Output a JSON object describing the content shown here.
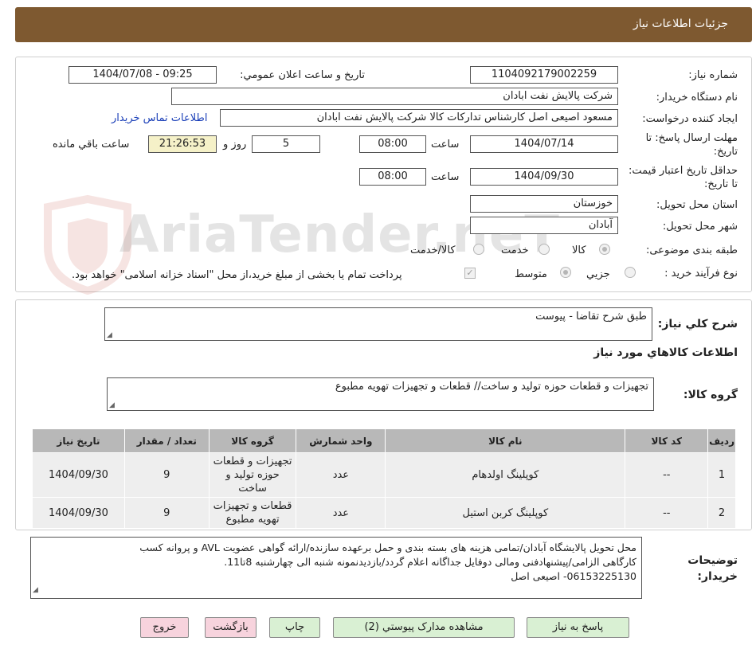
{
  "header": {
    "title": "جزئيات اطلاعات نياز"
  },
  "watermark": {
    "text": "AriaTender.neT"
  },
  "form": {
    "need_number_label": "شماره نياز:",
    "need_number": "1104092179002259",
    "announce_label": "تاريخ و ساعت اعلان عمومي:",
    "announce_value": "1404/07/08 - 09:25",
    "buyer_label": "نام دستگاه خريدار:",
    "buyer_value": "شرکت پالايش نفت ابادان",
    "creator_label": "ايجاد کننده درخواست:",
    "creator_value": "مسعود اصيعی اصل کارشناس تداركات كالا  شركت پالايش نفت ابادان",
    "contact_link": "اطلاعات تماس خريدار",
    "deadline_label": "مهلت ارسال پاسخ: تا تاريخ:",
    "deadline_date": "1404/07/14",
    "time_label": "ساعت",
    "deadline_time": "08:00",
    "days_value": "5",
    "days_label": "روز و",
    "remaining_time": "21:26:53",
    "remaining_label": "ساعت باقي مانده",
    "validity_label": "حداقل تاريخ اعتبار قيمت: تا تاريخ:",
    "validity_date": "1404/09/30",
    "validity_time": "08:00",
    "province_label": "استان محل تحويل:",
    "province_value": "خوزستان",
    "city_label": "شهر محل تحويل:",
    "city_value": "آبادان",
    "category_label": "طبقه بندی موضوعی:",
    "category_options": [
      "کالا",
      "خدمت",
      "کالا/خدمت"
    ],
    "category_selected": "کالا",
    "process_label": "نوع فرآيند خريد :",
    "process_options": [
      "جزيي",
      "متوسط"
    ],
    "process_selected": "متوسط",
    "payment_note": "پرداخت تمام يا بخشی از مبلغ خريد،از محل \"اسناد خزانه اسلامی\" خواهد بود."
  },
  "details": {
    "summary_label": "شرح کلي نياز:",
    "summary_value": "طبق شرح تقاضا - پيوست",
    "goods_info_title": "اطلاعات کالاهاي مورد نياز",
    "group_label": "گروه کالا:",
    "group_value": "تجهيزات و قطعات حوزه توليد و ساخت//  قطعات و تجهيزات تهويه مطبوع"
  },
  "table": {
    "headers": [
      "رديف",
      "کد کالا",
      "نام کالا",
      "واحد شمارش",
      "گروه کالا",
      "تعداد / مقدار",
      "تاريخ نياز"
    ],
    "rows": [
      [
        "1",
        "--",
        "کوپلينگ اولدهام",
        "عدد",
        "تجهيزات و قطعات حوزه توليد و ساخت",
        "9",
        "1404/09/30"
      ],
      [
        "2",
        "--",
        "کوپلينگ کربن استيل",
        "عدد",
        "قطعات و تجهيزات تهويه مطبوع",
        "9",
        "1404/09/30"
      ]
    ]
  },
  "notes": {
    "label": "توضيحات خريدار:",
    "line1": "محل تحويل پالايشگاه آبادان/تمامی هزينه های بسته بندی و حمل برعهده سازنده/ارائه گواهی عضويت AVL و پروانه کسب",
    "line2": "کارگاهی الزامی/پيشنهادفنی ومالی دوفايل جداگانه اعلام گردد/بازديدنمونه شنبه الی چهارشنبه 8تا11.",
    "line3": "06153225130- اصيعی اصل"
  },
  "buttons": {
    "reply": "پاسخ به نياز",
    "attachments": "مشاهده مدارک پيوستي (2)",
    "print": "چاپ",
    "back": "بازگشت",
    "exit": "خروج"
  },
  "colors": {
    "header_bg": "#7e5930",
    "green_button": "#d9f0d3",
    "pink_button": "#f7d3dd",
    "table_header": "#b8b8b8",
    "table_cell": "#eeeeee"
  }
}
